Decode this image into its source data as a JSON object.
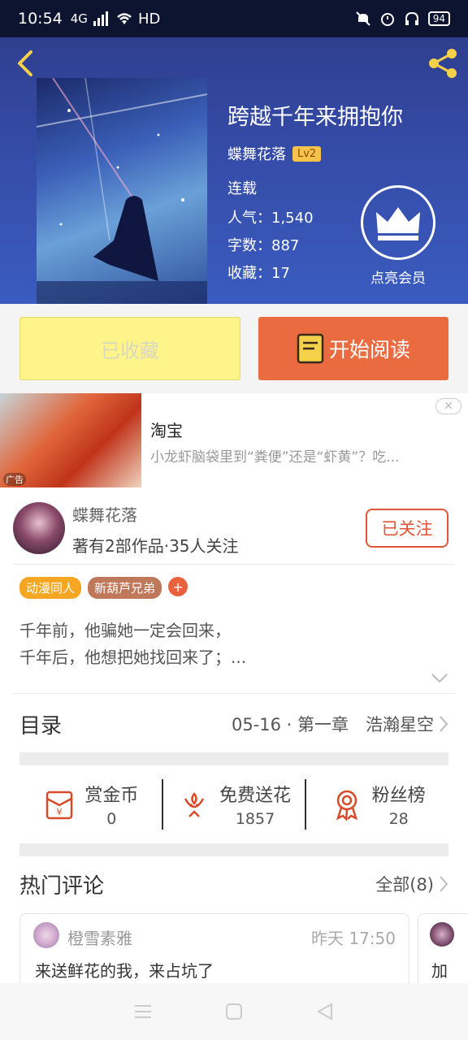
{
  "status_bar": {
    "time": "10:54",
    "signal_label": "4G",
    "hd_label": "HD",
    "battery": "94"
  },
  "book": {
    "title": "跨越千年来拥抱你",
    "author": "蝶舞花落",
    "level": "Lv2",
    "status": "连载",
    "popularity": "人气：1,540",
    "word_count": "字数：887",
    "favorites": "收藏：17",
    "vip_label": "点亮会员"
  },
  "actions": {
    "favorited_label": "已收藏",
    "read_label": "开始阅读"
  },
  "ad": {
    "title": "淘宝",
    "description": "小龙虾脑袋里到“粪便”还是“虾黄”？吃...",
    "tag": "广告"
  },
  "author_card": {
    "name": "蝶舞花落",
    "info": "著有2部作品·35人关注",
    "follow_label": "已关注"
  },
  "tags": [
    "动漫同人",
    "新葫芦兄弟"
  ],
  "add_tag": "+",
  "synopsis": {
    "line1": "千年前，他骗她一定会回来，",
    "line2": "千年后，他想把她找回来了；..."
  },
  "catalog": {
    "title": "目录",
    "latest": "05-16 · 第一章　浩瀚星空"
  },
  "stats": [
    {
      "label": "赏金币",
      "value": "0",
      "icon": "red-envelope-icon"
    },
    {
      "label": "免费送花",
      "value": "1857",
      "icon": "flower-icon"
    },
    {
      "label": "粉丝榜",
      "value": "28",
      "icon": "medal-icon"
    }
  ],
  "comments": {
    "title": "热门评论",
    "all_label": "全部(8)",
    "items": [
      {
        "user": "橙雪素雅",
        "time": "昨天 17:50",
        "text": "来送鲜花的我，来占坑了"
      },
      {
        "user": "",
        "time": "",
        "text": "加"
      }
    ]
  },
  "colors": {
    "accent_orange": "#ea6b3f",
    "fav_yellow": "#fef48a",
    "hero_blue": "#354ca8",
    "level_badge": "#f5c24c"
  }
}
